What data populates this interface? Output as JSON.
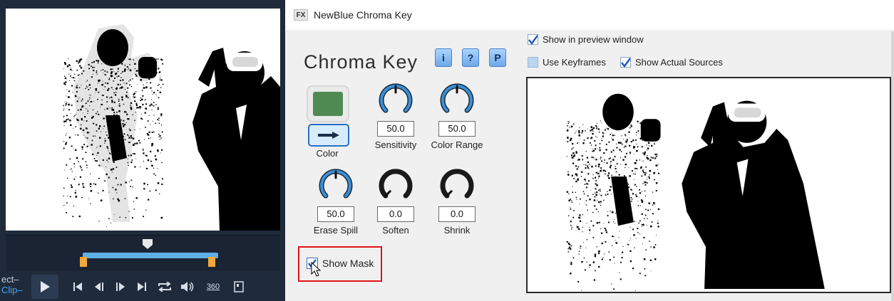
{
  "editor": {
    "mode_labels": [
      "ect–",
      "Clip–"
    ],
    "transport": {
      "play_icon": "play-icon",
      "buttons": [
        "previous-icon",
        "step-back-icon",
        "step-forward-icon",
        "next-icon",
        "repeat-icon",
        "volume-icon",
        "360-icon",
        "crop-icon"
      ],
      "label_360": "360"
    }
  },
  "dialog": {
    "logo": "FX",
    "title": "NewBlue Chroma Key",
    "heading": "Chroma Key",
    "help_buttons": [
      "i",
      "?",
      "P"
    ],
    "color": {
      "label": "Color",
      "swatch": "#4f8a52"
    },
    "knobs": [
      {
        "label": "Sensitivity",
        "value": "50.0",
        "level": 0.5,
        "color": "blue"
      },
      {
        "label": "Color Range",
        "value": "50.0",
        "level": 0.5,
        "color": "blue"
      },
      {
        "label": "Erase Spill",
        "value": "50.0",
        "level": 0.5,
        "color": "blue"
      },
      {
        "label": "Soften",
        "value": "0.0",
        "level": 0.0,
        "color": "black"
      },
      {
        "label": "Shrink",
        "value": "0.0",
        "level": 0.0,
        "color": "black"
      }
    ],
    "show_mask": {
      "label": "Show Mask",
      "checked": true
    },
    "options": {
      "show_in_preview": {
        "label": "Show in preview window",
        "checked": true
      },
      "use_keyframes": {
        "label": "Use Keyframes",
        "checked": false
      },
      "show_actual_sources": {
        "label": "Show Actual Sources",
        "checked": true
      }
    }
  },
  "colors": {
    "accent": "#4a8fd6",
    "highlight": "#e0131a",
    "trim": "#5fb0e8",
    "trim_handle": "#f0a93a"
  }
}
